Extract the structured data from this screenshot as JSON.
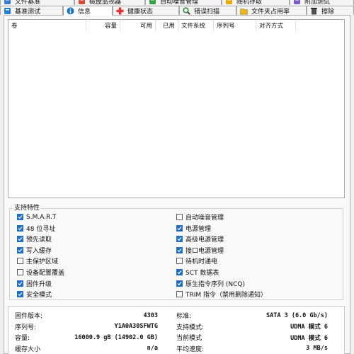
{
  "tabs_row1": [
    {
      "label": "文件基准",
      "icon": "benchmark-file-icon"
    },
    {
      "label": "磁盘监视器",
      "icon": "disk-monitor-icon"
    },
    {
      "label": "自动噪音管理",
      "icon": "aam-icon"
    },
    {
      "label": "随机存取",
      "icon": "random-access-icon"
    },
    {
      "label": "附加测试",
      "icon": "extra-tests-icon"
    }
  ],
  "tabs_row2": [
    {
      "label": "基准测试",
      "icon": "benchmark-icon"
    },
    {
      "label": "信息",
      "icon": "info-icon",
      "active": true
    },
    {
      "label": "健康状态",
      "icon": "health-icon"
    },
    {
      "label": "错误扫描",
      "icon": "error-scan-icon"
    },
    {
      "label": "文件夹占用率",
      "icon": "folder-usage-icon"
    },
    {
      "label": "擦除",
      "icon": "erase-icon"
    }
  ],
  "partition_table": {
    "columns": [
      "卷",
      "容量",
      "可用",
      "已用",
      "文件系统",
      "序列号",
      "对齐方式"
    ],
    "rows": []
  },
  "features": {
    "title": "支持特性",
    "left": [
      {
        "label": "S.M.A.R.T",
        "checked": true
      },
      {
        "label": "48 位寻址",
        "checked": true
      },
      {
        "label": "预先读取",
        "checked": true
      },
      {
        "label": "写入缓存",
        "checked": true
      },
      {
        "label": "主保护区域",
        "checked": false
      },
      {
        "label": "设备配置覆盖",
        "checked": false
      },
      {
        "label": "固件升级",
        "checked": true
      },
      {
        "label": "安全模式",
        "checked": true
      }
    ],
    "right": [
      {
        "label": "自动噪音管理",
        "checked": false
      },
      {
        "label": "电源管理",
        "checked": true
      },
      {
        "label": "高级电源管理",
        "checked": true
      },
      {
        "label": "接口电源管理",
        "checked": true
      },
      {
        "label": "待机时通电",
        "checked": false
      },
      {
        "label": "SCT 数据表",
        "checked": true
      },
      {
        "label": "原生指令序列 (NCQ)",
        "checked": true
      },
      {
        "label": "TRIM 指令（禁用删除通知）",
        "checked": false
      }
    ]
  },
  "info": {
    "left": [
      {
        "label": "固件版本:",
        "value": "4303"
      },
      {
        "label": "序列号:",
        "value": "Y1A0A30SFWTG"
      },
      {
        "label": "容量:",
        "value": "16000.9 gB (14902.0 GB)"
      },
      {
        "label": "缓存大小",
        "value": "n/a"
      }
    ],
    "right": [
      {
        "label": "标准:",
        "value": "SATA 3 (6.0 Gb/s)"
      },
      {
        "label": "支持模式:",
        "value": "UDMA 模式 6"
      },
      {
        "label": "当前模式",
        "value": "UDMA 模式 6"
      },
      {
        "label": "平均速度:",
        "value": "3 MB/s"
      }
    ]
  }
}
